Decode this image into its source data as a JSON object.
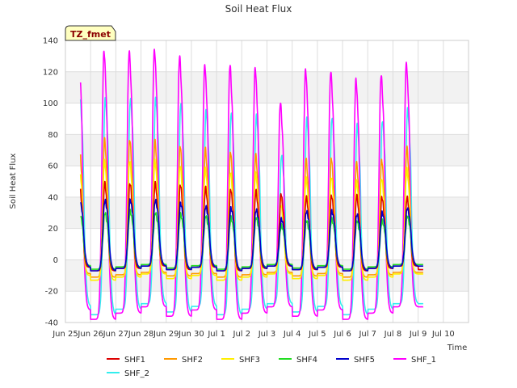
{
  "chart_data": {
    "type": "line",
    "title": "Soil Heat Flux",
    "xlabel": "Time",
    "ylabel": "Soil Heat Flux",
    "tag": "TZ_fmet",
    "xlim": [
      0,
      16
    ],
    "ylim": [
      -40,
      140
    ],
    "x_ticks": [
      {
        "x": 0,
        "label": "Jun 25"
      },
      {
        "x": 1,
        "label": "Jun 26"
      },
      {
        "x": 2,
        "label": "Jun 27"
      },
      {
        "x": 3,
        "label": "Jun 28"
      },
      {
        "x": 4,
        "label": "Jun 29"
      },
      {
        "x": 5,
        "label": "Jun 30"
      },
      {
        "x": 6,
        "label": "Jul 1"
      },
      {
        "x": 7,
        "label": "Jul 2"
      },
      {
        "x": 8,
        "label": "Jul 3"
      },
      {
        "x": 9,
        "label": "Jul 4"
      },
      {
        "x": 10,
        "label": "Jul 5"
      },
      {
        "x": 11,
        "label": "Jul 6"
      },
      {
        "x": 12,
        "label": "Jul 7"
      },
      {
        "x": 13,
        "label": "Jul 8"
      },
      {
        "x": 14,
        "label": "Jul 9"
      },
      {
        "x": 15,
        "label": "Jul 10"
      }
    ],
    "y_ticks": [
      -40,
      -20,
      0,
      20,
      40,
      60,
      80,
      100,
      120,
      140
    ],
    "grid": true,
    "legend_position": "bottom",
    "series": [
      {
        "name": "SHF1",
        "color": "#dd0000",
        "peak_day": 0.56,
        "width": 0.075,
        "night": [
          -7,
          -4
        ],
        "peaks": [
          48,
          49,
          49,
          49,
          48,
          46,
          45,
          44,
          42,
          40,
          41,
          41,
          40,
          40,
          44
        ]
      },
      {
        "name": "SHF2",
        "color": "#ff9900",
        "peak_day": 0.55,
        "width": 0.075,
        "night": [
          -11,
          -8
        ],
        "peaks": [
          76,
          77,
          77,
          76,
          73,
          71,
          69,
          67,
          40,
          64,
          65,
          62,
          64,
          72
        ]
      },
      {
        "name": "SHF3",
        "color": "#ffee00",
        "peak_day": 0.55,
        "width": 0.08,
        "night": [
          -13,
          -9
        ],
        "peaks": [
          62,
          63,
          63,
          63,
          60,
          58,
          56,
          55,
          35,
          52,
          53,
          50,
          52,
          58
        ]
      },
      {
        "name": "SHF4",
        "color": "#22dd22",
        "peak_day": 0.57,
        "width": 0.085,
        "night": [
          -6,
          -3
        ],
        "peaks": [
          30,
          30,
          31,
          30,
          29,
          28,
          27,
          27,
          22,
          25,
          26,
          25,
          25,
          28
        ]
      },
      {
        "name": "SHF5",
        "color": "#0000cc",
        "peak_day": 0.57,
        "width": 0.09,
        "night": [
          -7,
          -4
        ],
        "peaks": [
          38,
          38,
          38,
          38,
          36,
          34,
          33,
          32,
          26,
          31,
          31,
          29,
          30,
          33
        ]
      },
      {
        "name": "SHF_1",
        "color": "#ff00ff",
        "peak_day": 0.53,
        "width": 0.09,
        "night": [
          -38,
          -30
        ],
        "peaks": [
          133,
          133,
          133,
          134,
          130,
          124,
          124,
          122,
          100,
          121,
          120,
          115,
          118,
          125
        ]
      },
      {
        "name": "SHF_2",
        "color": "#33eeee",
        "peak_day": 0.58,
        "width": 0.09,
        "night": [
          -35,
          -28
        ],
        "peaks": [
          103,
          103,
          103,
          103,
          100,
          95,
          94,
          92,
          67,
          90,
          91,
          86,
          89,
          96
        ]
      }
    ],
    "x_start": 0.6,
    "x_end": 14.2
  }
}
